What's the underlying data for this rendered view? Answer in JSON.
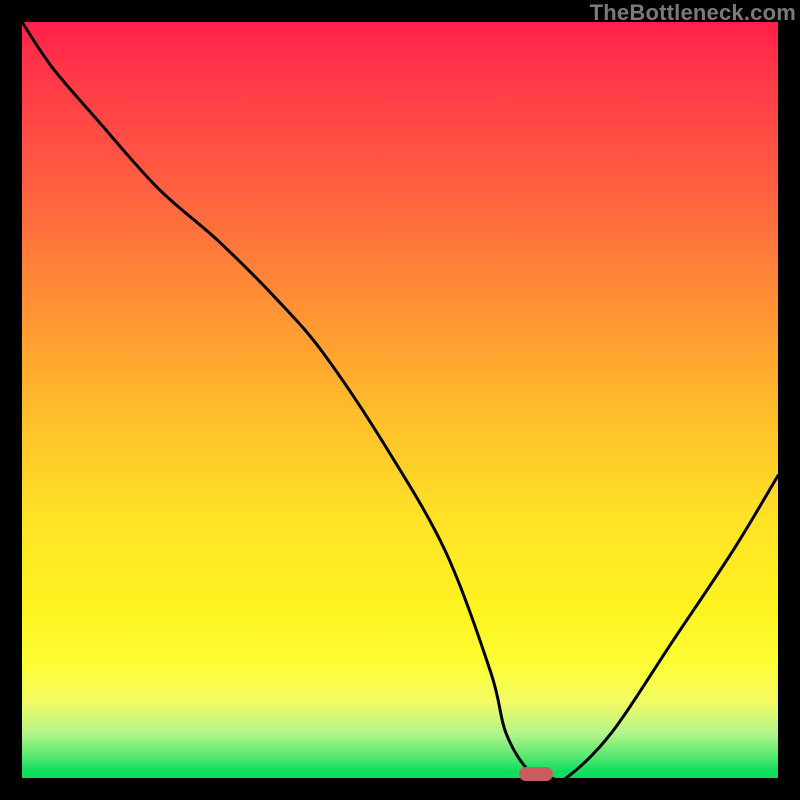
{
  "watermark": "TheBottleneck.com",
  "colors": {
    "frame_bg": "#000000",
    "marker": "#c95e5e",
    "curve": "#000000"
  },
  "chart_data": {
    "type": "line",
    "title": "",
    "xlabel": "",
    "ylabel": "",
    "xlim": [
      0,
      100
    ],
    "ylim": [
      0,
      100
    ],
    "grid": false,
    "legend": false,
    "series": [
      {
        "name": "bottleneck-curve",
        "x": [
          0,
          4,
          10,
          18,
          26,
          34,
          40,
          48,
          56,
          62,
          64,
          67,
          70,
          72,
          78,
          86,
          94,
          100
        ],
        "y": [
          100,
          94,
          87,
          78,
          71,
          63,
          56,
          44,
          30,
          14,
          6,
          1,
          0,
          0,
          6,
          18,
          30,
          40
        ]
      }
    ],
    "marker": {
      "x": 68,
      "y": 0.5,
      "width_pct": 4.5,
      "height_pct": 1.85
    },
    "gradient_stops": [
      {
        "pct": 0,
        "color": "#ff1f4a"
      },
      {
        "pct": 20,
        "color": "#ff5a42"
      },
      {
        "pct": 52,
        "color": "#ffbe2b"
      },
      {
        "pct": 78,
        "color": "#fff420"
      },
      {
        "pct": 99,
        "color": "#12df5f"
      },
      {
        "pct": 100,
        "color": "#0cdc5c"
      }
    ]
  }
}
